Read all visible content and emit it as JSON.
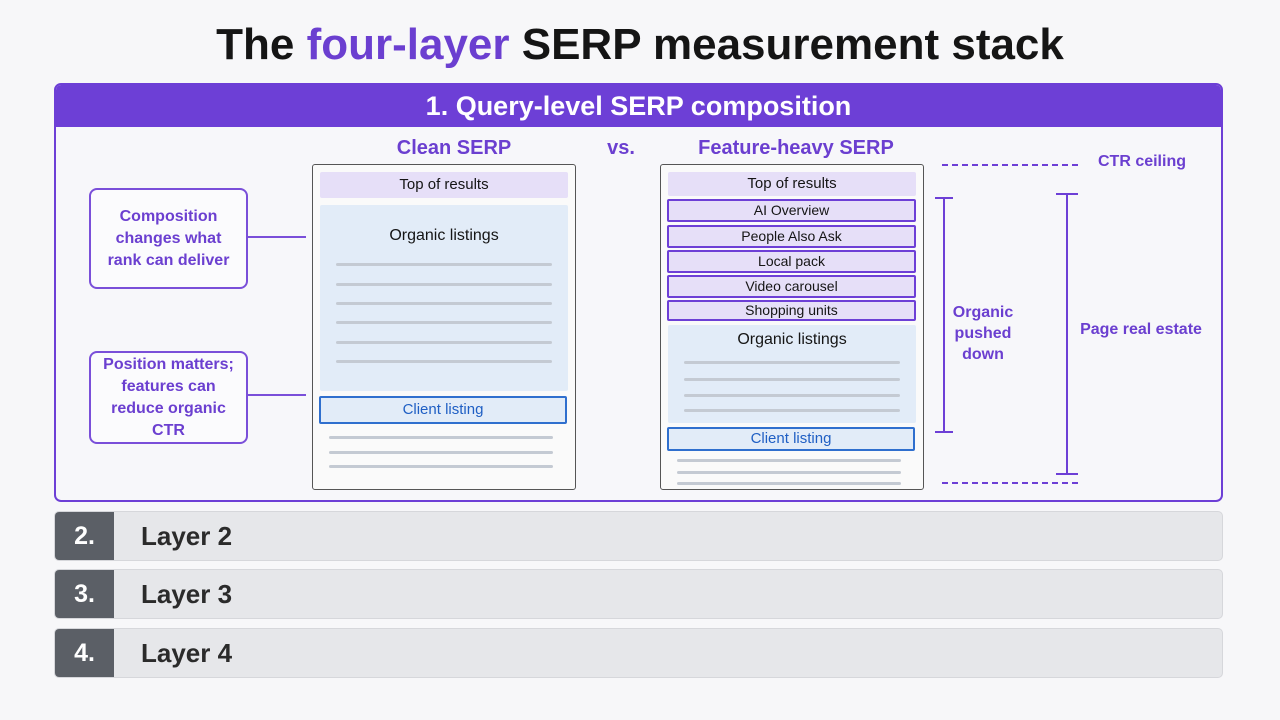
{
  "title": {
    "prefix": "The ",
    "accent": "four-layer",
    "suffix": " SERP measurement stack",
    "accent_color": "#6b3fd0"
  },
  "panel": {
    "header": "1. Query-level SERP composition",
    "color": "#6d3fd6",
    "clean_title": "Clean SERP",
    "vs": "vs.",
    "heavy_title": "Feature-heavy SERP",
    "callouts": [
      "Composition changes what rank can deliver",
      "Position matters; features can reduce organic CTR"
    ],
    "clean": {
      "top": "Top of results",
      "organic": "Organic listings",
      "client": "Client listing"
    },
    "heavy": {
      "top": "Top of results",
      "features": [
        "AI Overview",
        "People Also Ask",
        "Local pack",
        "Video carousel",
        "Shopping units"
      ],
      "organic": "Organic listings",
      "client": "Client listing"
    },
    "annotations": {
      "ctr_ceiling": "CTR ceiling",
      "organic_pushed_down": "Organic pushed down",
      "page_real_estate": "Page real estate"
    }
  },
  "layers": [
    {
      "num": "2.",
      "label": "Layer 2"
    },
    {
      "num": "3.",
      "label": "Layer 3"
    },
    {
      "num": "4.",
      "label": "Layer 4"
    }
  ]
}
